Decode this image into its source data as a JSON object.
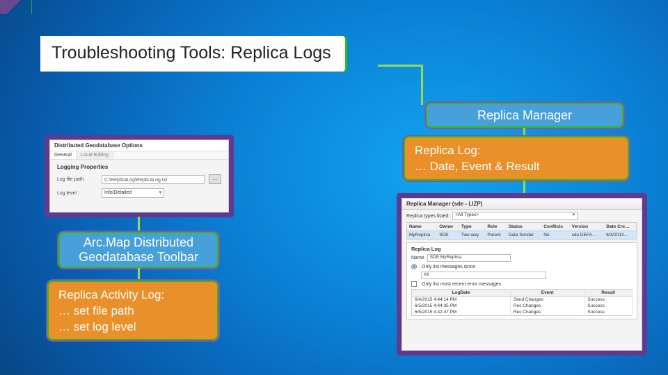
{
  "title": "Troubleshooting Tools: Replica Logs",
  "left": {
    "card_label": "Arc.Map Distributed Geodatabase Toolbar",
    "orange": {
      "line1": "Replica Activity Log:",
      "line2": "… set file path",
      "line3": "… set log level"
    },
    "dialog": {
      "title": "Distributed Geodatabase Options",
      "tab_active": "General",
      "tab_inactive": "Local Editing",
      "section": "Logging Properties",
      "row1_label": "Log file path",
      "row1_value": "C:\\ReplicaLog\\ReplicaLog.txt",
      "row1_button": "…",
      "row2_label": "Log level :",
      "row2_value": "Info/Detailed"
    }
  },
  "right": {
    "card_label": "Replica Manager",
    "orange": {
      "line1": "Replica Log:",
      "line2": "… Date, Event & Result"
    },
    "rm": {
      "window_title": "Replica Manager (sde - LIZP)",
      "types_label": "Replica types listed:",
      "types_value": "<All Types>",
      "cols": [
        "Name",
        "Owner",
        "Type",
        "Role",
        "Status",
        "Conflicts",
        "Version",
        "Date Cre…"
      ],
      "row_sel": [
        "MyReplica",
        "SDE",
        "Two way",
        "Parent",
        "Data Sender",
        "No",
        "sde.DEFA…",
        "6/3/2013…"
      ],
      "sub_title": "Replica Log",
      "name_label": "Name",
      "name_value": "SDE.MyReplica",
      "opt_since": "Only list messages since",
      "opt_since_val": "All",
      "opt_recent": "Only list most recent error messages",
      "log_cols": [
        "LogDate",
        "Event",
        "Result"
      ],
      "log_rows": [
        [
          "6/4/2015 4:44:14 PM",
          "Send Changes",
          "Success"
        ],
        [
          "6/5/2015 4:44:35 PM",
          "Rec Changes",
          "Success"
        ],
        [
          "6/5/2015 4:42:47 PM",
          "Rec Changes",
          "Success"
        ]
      ]
    }
  }
}
